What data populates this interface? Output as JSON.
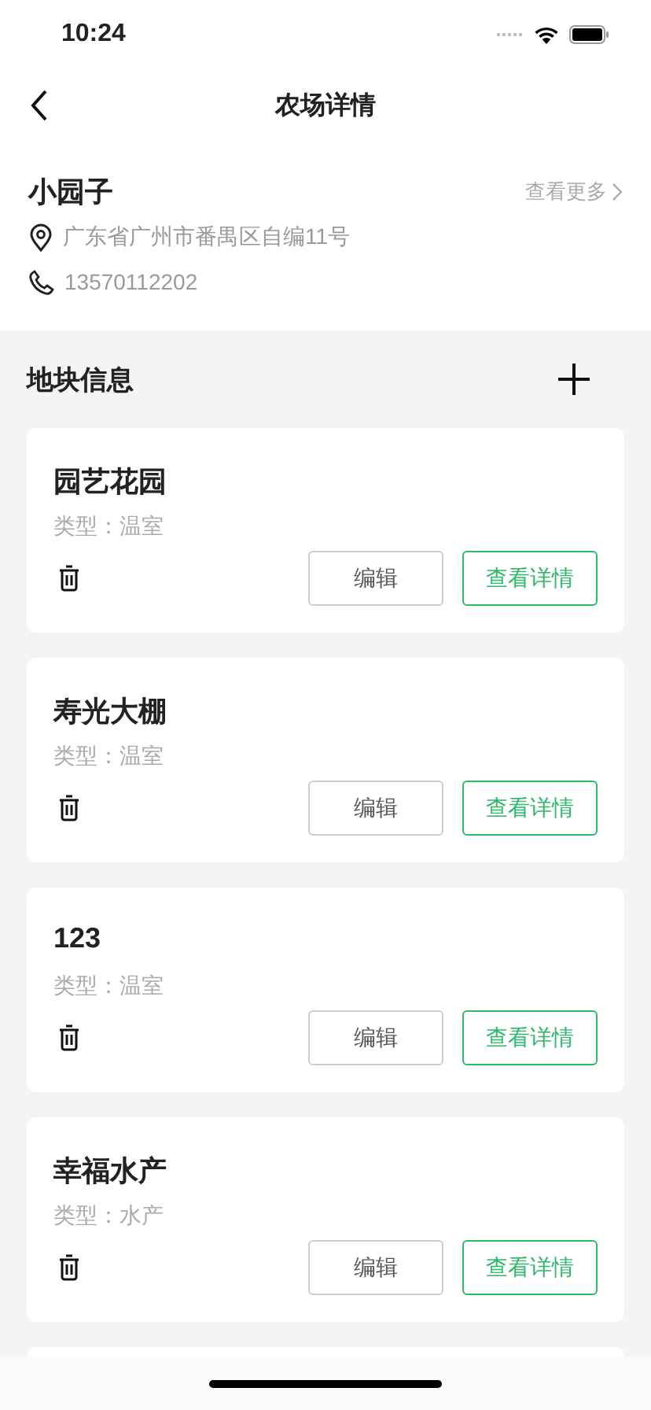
{
  "status_bar": {
    "time": "10:24"
  },
  "nav": {
    "title": "农场详情"
  },
  "farm": {
    "name": "小园子",
    "more": "查看更多",
    "address": "广东省广州市番禺区自编11号",
    "phone": "13570112202"
  },
  "section": {
    "title": "地块信息"
  },
  "plots": [
    {
      "name": "园艺花园",
      "type": "类型：温室",
      "edit": "编辑",
      "detail": "查看详情"
    },
    {
      "name": "寿光大棚",
      "type": "类型：温室",
      "edit": "编辑",
      "detail": "查看详情"
    },
    {
      "name": "123",
      "type": "类型：温室",
      "edit": "编辑",
      "detail": "查看详情"
    },
    {
      "name": "幸福水产",
      "type": "类型：水产",
      "edit": "编辑",
      "detail": "查看详情"
    }
  ]
}
